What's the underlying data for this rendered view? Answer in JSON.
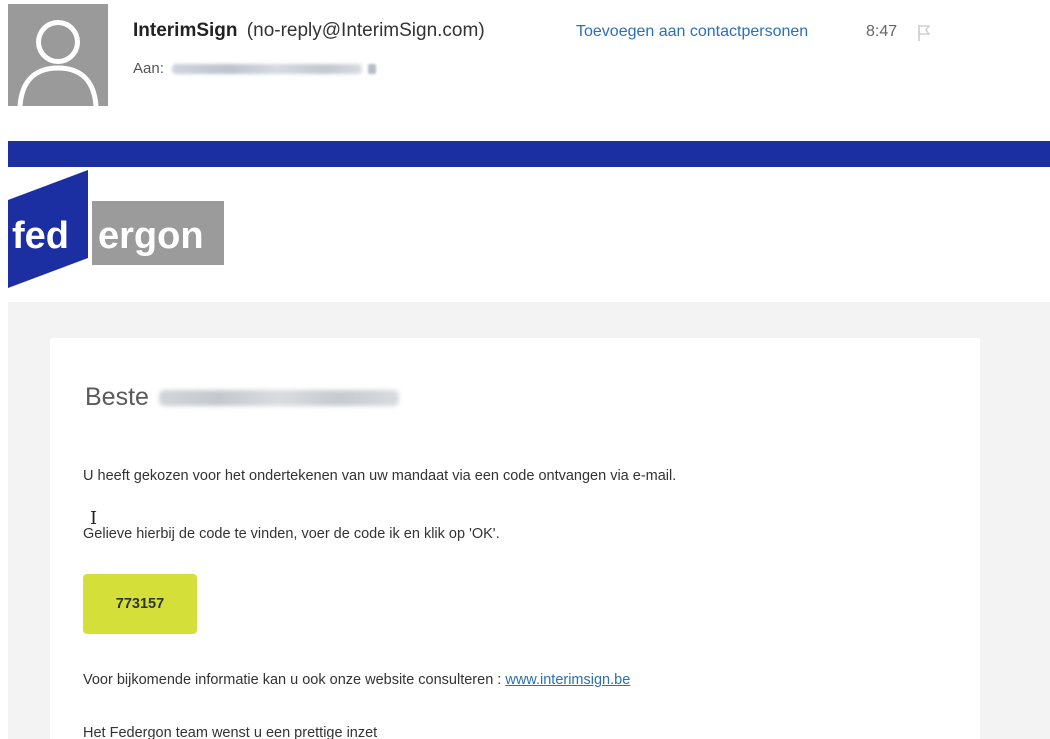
{
  "header": {
    "sender_name": "InterimSign",
    "sender_address": "(no-reply@InterimSign.com)",
    "add_contact_label": "Toevoegen aan contactpersonen",
    "time": "8:47",
    "to_label": "Aan:"
  },
  "branding": {
    "logo_part1": "fed",
    "logo_part2": "ergon",
    "bar_color": "#1b2fa3"
  },
  "body": {
    "greeting": "Beste",
    "line1": "U heeft gekozen voor het ondertekenen van uw mandaat via een code ontvangen via e-mail.",
    "line2": "Gelieve hierbij de code te vinden, voer de code ik en klik op 'OK'.",
    "code": "773157",
    "line3_prefix": "Voor bijkomende informatie kan u ook onze website consulteren :",
    "link": "www.interimsign.be",
    "line4": "Het Federgon team wenst u een prettige inzet"
  },
  "colors": {
    "code_highlight": "#d5df3a",
    "link": "#2b6fb6"
  },
  "icons": {
    "avatar": "person-avatar-icon",
    "flag": "flag-icon",
    "cursor": "text-cursor-icon"
  }
}
